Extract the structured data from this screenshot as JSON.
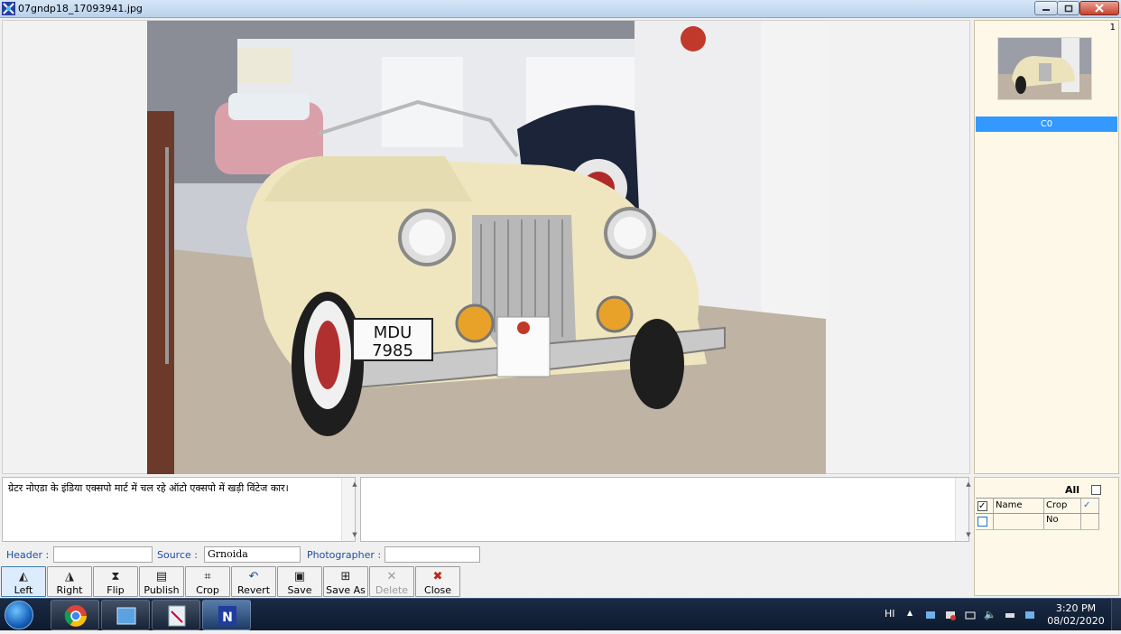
{
  "window": {
    "title": "07gndp18_17093941.jpg",
    "buttons": {
      "minimize": "minimize",
      "maximize": "maximize",
      "close": "close"
    }
  },
  "photo": {
    "plate_line1": "MDU",
    "plate_line2": "7985"
  },
  "thumbnails": {
    "count": "1",
    "selected_label": "C0"
  },
  "caption": {
    "text": "ग्रेटर नोएडा के इंडिया एक्सपो मार्ट में चल रहे ऑटो एक्सपो में खड़ी विंटेज कार।",
    "secondary": ""
  },
  "crop_grid": {
    "all_label": "All",
    "columns": {
      "name": "Name",
      "crop_no": "Crop No"
    },
    "rows": [
      {
        "name": "",
        "crop_no": ""
      }
    ]
  },
  "fields": {
    "header_label": "Header :",
    "header_value": "",
    "source_label": "Source :",
    "source_value": "Grnoida",
    "photographer_label": "Photographer :",
    "photographer_value": ""
  },
  "toolbar": {
    "left": "Left",
    "right": "Right",
    "flip": "Flip",
    "publish": "Publish",
    "crop": "Crop",
    "revert": "Revert",
    "save": "Save",
    "save_as": "Save As",
    "delete": "Delete",
    "close": "Close"
  },
  "taskbar": {
    "language": "HI",
    "time": "3:20 PM",
    "date": "08/02/2020"
  }
}
